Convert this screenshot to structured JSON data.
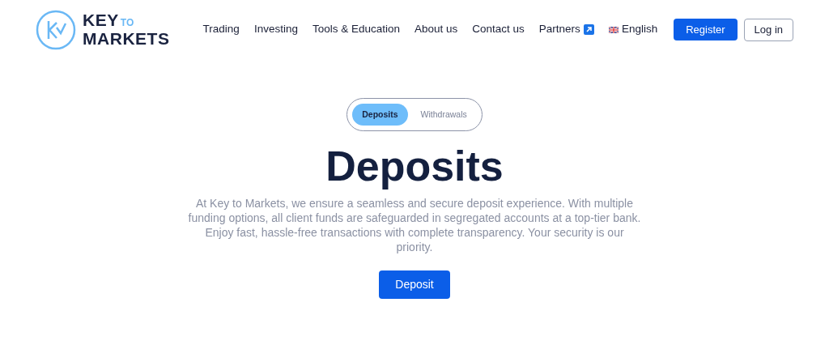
{
  "logo": {
    "line1": "KEY",
    "small": "TO",
    "line2": "MARKETS"
  },
  "nav": [
    {
      "label": "Trading",
      "kind": "link"
    },
    {
      "label": "Investing",
      "kind": "link"
    },
    {
      "label": "Tools & Education",
      "kind": "link"
    },
    {
      "label": "About us",
      "kind": "link"
    },
    {
      "label": "Contact us",
      "kind": "link"
    },
    {
      "label": "Partners",
      "kind": "external"
    },
    {
      "label": "English",
      "kind": "language"
    }
  ],
  "buttons": [
    {
      "label": "Register",
      "kind": "primary"
    },
    {
      "label": "Log in",
      "kind": "outline"
    }
  ],
  "tabs": [
    {
      "label": "Deposits",
      "selected": true
    },
    {
      "label": "Withdrawals",
      "selected": false
    }
  ],
  "heading": "Deposits",
  "description": "At Key to Markets, we ensure a seamless and secure deposit experience. With multiple funding options, all client funds are safeguarded in segregated accounts at a top-tier bank. Enjoy fast, hassle-free transactions with complete transparency. Your security is our priority.",
  "cta": "Deposit"
}
